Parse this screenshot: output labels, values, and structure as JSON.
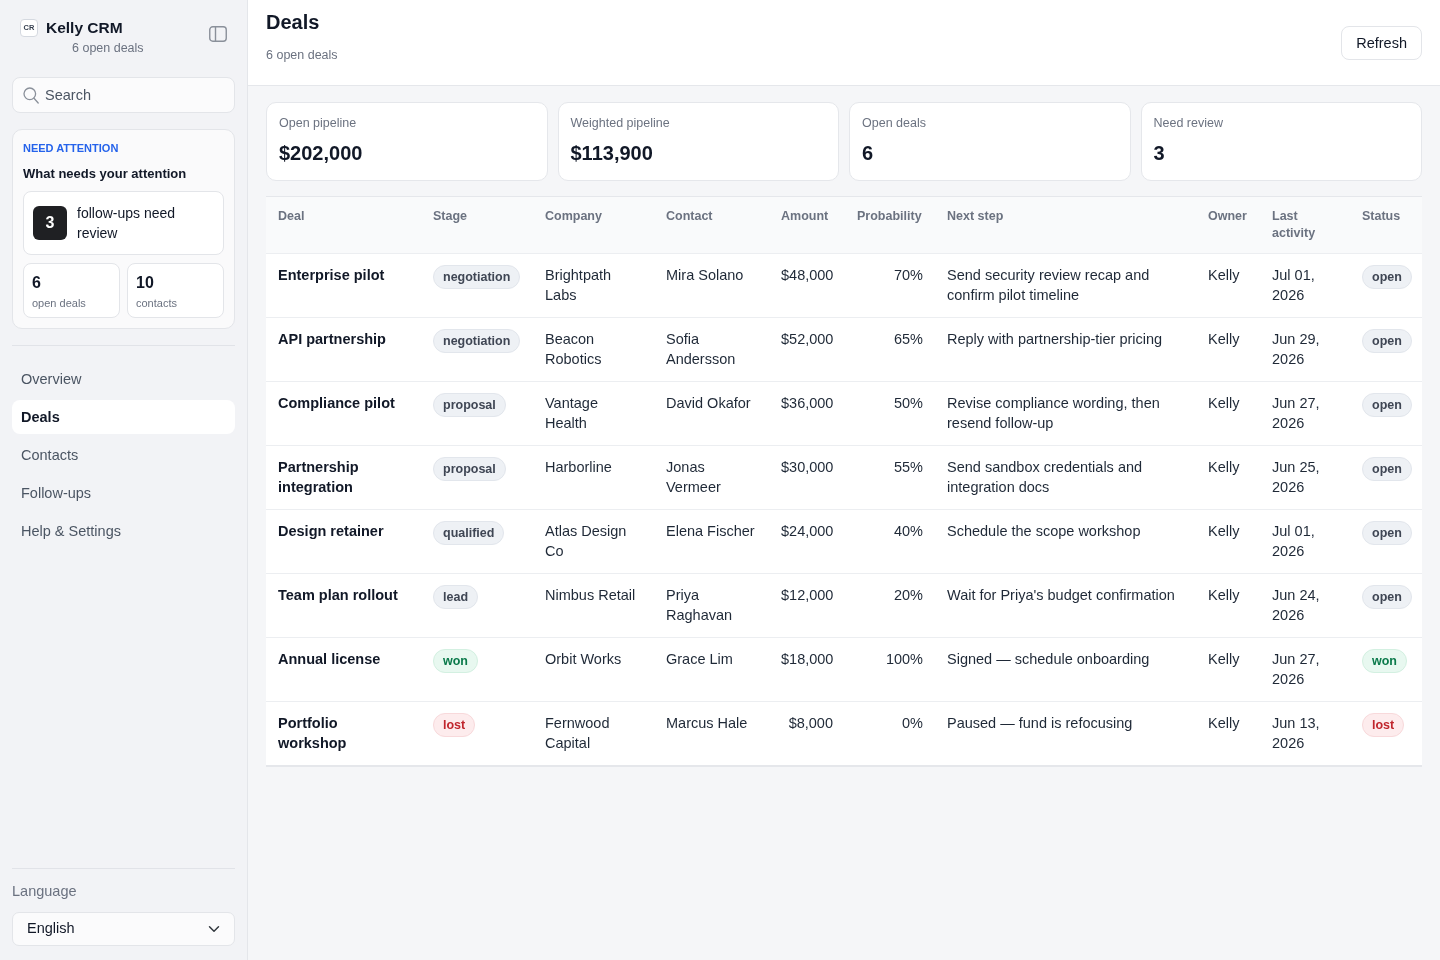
{
  "sidebar": {
    "brand": {
      "logo": "CR",
      "name": "Kelly CRM",
      "subtitle": "6 open deals"
    },
    "search": {
      "placeholder": "Search"
    },
    "attention": {
      "eyebrow": "NEED ATTENTION",
      "title": "What needs your attention",
      "highlight": {
        "count": "3",
        "label": "follow-ups need review"
      },
      "stats": [
        {
          "value": "6",
          "label": "open deals"
        },
        {
          "value": "10",
          "label": "contacts"
        }
      ]
    },
    "nav": [
      {
        "label": "Overview",
        "selected": false
      },
      {
        "label": "Deals",
        "selected": true
      },
      {
        "label": "Contacts",
        "selected": false
      },
      {
        "label": "Follow-ups",
        "selected": false
      },
      {
        "label": "Help & Settings",
        "selected": false
      }
    ],
    "language": {
      "label": "Language",
      "value": "English"
    }
  },
  "header": {
    "title": "Deals",
    "subtitle": "6 open deals",
    "button": "Refresh"
  },
  "stats": [
    {
      "label": "Open pipeline",
      "value": "$202,000"
    },
    {
      "label": "Weighted pipeline",
      "value": "$113,900"
    },
    {
      "label": "Open deals",
      "value": "6"
    },
    {
      "label": "Need review",
      "value": "3"
    }
  ],
  "table": {
    "columns": [
      "Deal",
      "Stage",
      "Company",
      "Contact",
      "Amount",
      "Probability",
      "Next step",
      "Owner",
      "Last activity",
      "Status"
    ],
    "rows": [
      {
        "deal": "Enterprise pilot",
        "stage": {
          "label": "negotiation",
          "kind": "neutral"
        },
        "company": "Brightpath Labs",
        "contact": "Mira Solano",
        "amount": "$48,000",
        "probability": "70%",
        "next_step": "Send security review recap and confirm pilot timeline",
        "owner": "Kelly",
        "last_activity": "Jul 01, 2026",
        "status": {
          "label": "open",
          "kind": "neutral"
        }
      },
      {
        "deal": "API partnership",
        "stage": {
          "label": "negotiation",
          "kind": "neutral"
        },
        "company": "Beacon Robotics",
        "contact": "Sofia Andersson",
        "amount": "$52,000",
        "probability": "65%",
        "next_step": "Reply with partnership-tier pricing",
        "owner": "Kelly",
        "last_activity": "Jun 29, 2026",
        "status": {
          "label": "open",
          "kind": "neutral"
        }
      },
      {
        "deal": "Compliance pilot",
        "stage": {
          "label": "proposal",
          "kind": "neutral"
        },
        "company": "Vantage Health",
        "contact": "David Okafor",
        "amount": "$36,000",
        "probability": "50%",
        "next_step": "Revise compliance wording, then resend follow-up",
        "owner": "Kelly",
        "last_activity": "Jun 27, 2026",
        "status": {
          "label": "open",
          "kind": "neutral"
        }
      },
      {
        "deal": "Partnership integration",
        "stage": {
          "label": "proposal",
          "kind": "neutral"
        },
        "company": "Harborline",
        "contact": "Jonas Vermeer",
        "amount": "$30,000",
        "probability": "55%",
        "next_step": "Send sandbox credentials and integration docs",
        "owner": "Kelly",
        "last_activity": "Jun 25, 2026",
        "status": {
          "label": "open",
          "kind": "neutral"
        }
      },
      {
        "deal": "Design retainer",
        "stage": {
          "label": "qualified",
          "kind": "neutral"
        },
        "company": "Atlas Design Co",
        "contact": "Elena Fischer",
        "amount": "$24,000",
        "probability": "40%",
        "next_step": "Schedule the scope workshop",
        "owner": "Kelly",
        "last_activity": "Jul 01, 2026",
        "status": {
          "label": "open",
          "kind": "neutral"
        }
      },
      {
        "deal": "Team plan rollout",
        "stage": {
          "label": "lead",
          "kind": "neutral"
        },
        "company": "Nimbus Retail",
        "contact": "Priya Raghavan",
        "amount": "$12,000",
        "probability": "20%",
        "next_step": "Wait for Priya's budget confirmation",
        "owner": "Kelly",
        "last_activity": "Jun 24, 2026",
        "status": {
          "label": "open",
          "kind": "neutral"
        }
      },
      {
        "deal": "Annual license",
        "stage": {
          "label": "won",
          "kind": "success"
        },
        "company": "Orbit Works",
        "contact": "Grace Lim",
        "amount": "$18,000",
        "probability": "100%",
        "next_step": "Signed — schedule onboarding",
        "owner": "Kelly",
        "last_activity": "Jun 27, 2026",
        "status": {
          "label": "won",
          "kind": "success"
        }
      },
      {
        "deal": "Portfolio workshop",
        "stage": {
          "label": "lost",
          "kind": "danger"
        },
        "company": "Fernwood Capital",
        "contact": "Marcus Hale",
        "amount": "$8,000",
        "probability": "0%",
        "next_step": "Paused — fund is refocusing",
        "owner": "Kelly",
        "last_activity": "Jun 13, 2026",
        "status": {
          "label": "lost",
          "kind": "danger"
        }
      }
    ]
  }
}
